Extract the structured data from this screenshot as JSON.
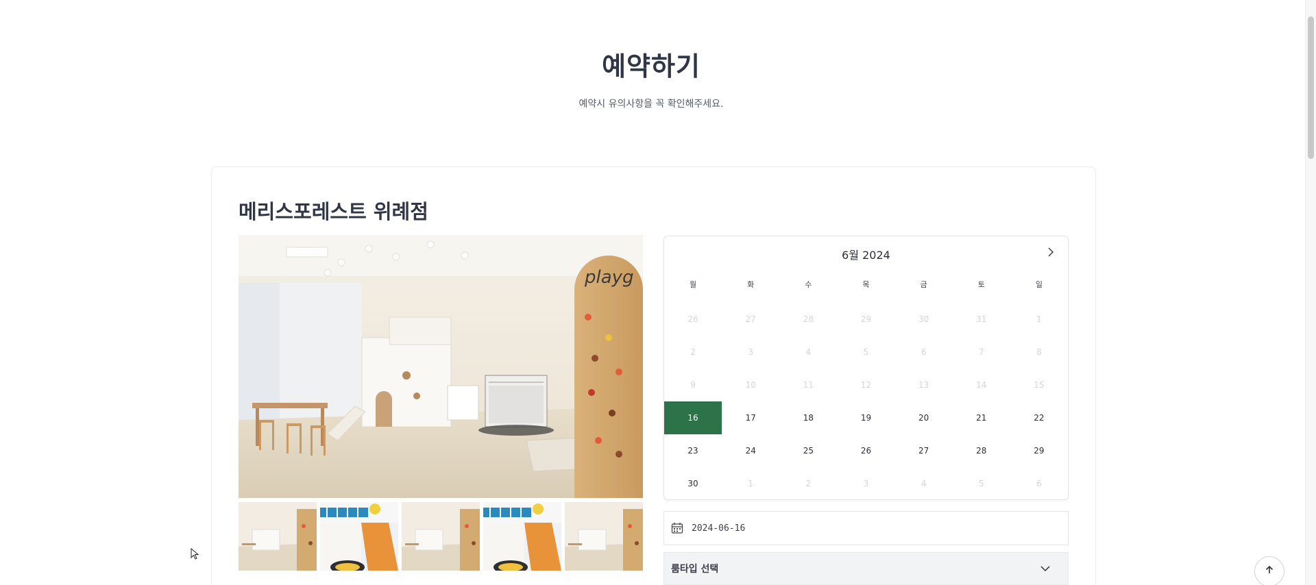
{
  "header": {
    "title": "예약하기",
    "subtitle": "예약시 유의사항을 꼭 확인해주세요."
  },
  "branch": {
    "name": "메리스포레스트 위례점"
  },
  "gallery": {
    "main_alt": "playroom main photo",
    "thumbnails": [
      "thumb-1",
      "thumb-2",
      "thumb-3",
      "thumb-4",
      "thumb-5"
    ]
  },
  "calendar": {
    "month_label": "6월  2024",
    "weekdays": [
      "월",
      "화",
      "수",
      "목",
      "금",
      "토",
      "일"
    ],
    "weeks": [
      [
        {
          "d": "26",
          "m": true
        },
        {
          "d": "27",
          "m": true
        },
        {
          "d": "28",
          "m": true
        },
        {
          "d": "29",
          "m": true
        },
        {
          "d": "30",
          "m": true
        },
        {
          "d": "31",
          "m": true
        },
        {
          "d": "1",
          "m": true
        }
      ],
      [
        {
          "d": "2",
          "m": true
        },
        {
          "d": "3",
          "m": true
        },
        {
          "d": "4",
          "m": true
        },
        {
          "d": "5",
          "m": true
        },
        {
          "d": "6",
          "m": true
        },
        {
          "d": "7",
          "m": true
        },
        {
          "d": "8",
          "m": true
        }
      ],
      [
        {
          "d": "9",
          "m": true
        },
        {
          "d": "10",
          "m": true
        },
        {
          "d": "11",
          "m": true
        },
        {
          "d": "12",
          "m": true
        },
        {
          "d": "13",
          "m": true
        },
        {
          "d": "14",
          "m": true
        },
        {
          "d": "15",
          "m": true
        }
      ],
      [
        {
          "d": "16",
          "s": true
        },
        {
          "d": "17"
        },
        {
          "d": "18"
        },
        {
          "d": "19"
        },
        {
          "d": "20"
        },
        {
          "d": "21"
        },
        {
          "d": "22"
        }
      ],
      [
        {
          "d": "23"
        },
        {
          "d": "24"
        },
        {
          "d": "25"
        },
        {
          "d": "26"
        },
        {
          "d": "27"
        },
        {
          "d": "28"
        },
        {
          "d": "29"
        }
      ],
      [
        {
          "d": "30"
        },
        {
          "d": "1",
          "m": true
        },
        {
          "d": "2",
          "m": true
        },
        {
          "d": "3",
          "m": true
        },
        {
          "d": "4",
          "m": true
        },
        {
          "d": "5",
          "m": true
        },
        {
          "d": "6",
          "m": true
        }
      ]
    ],
    "selected_color": "#2c7349"
  },
  "date_field": {
    "value": "2024-06-16"
  },
  "theme_select": {
    "label": "룸타입 선택"
  },
  "icons": {
    "next": "chevron-right-icon",
    "calendar": "calendar-icon",
    "dropdown": "chevron-down-icon",
    "scroll_top": "arrow-up-icon"
  }
}
